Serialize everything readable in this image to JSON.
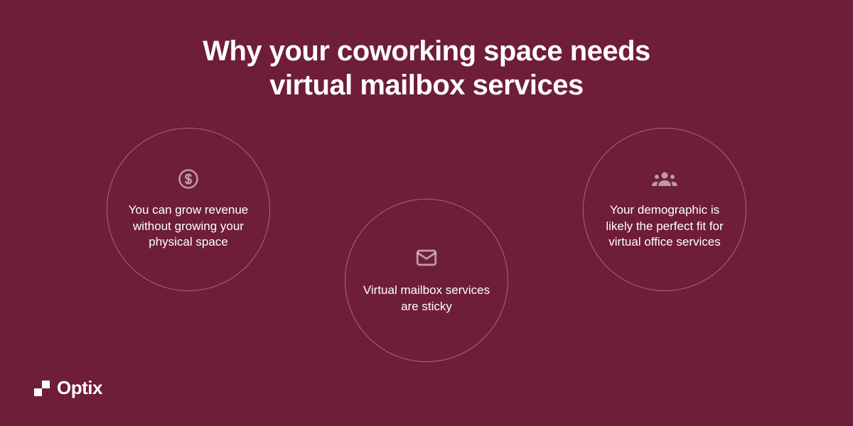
{
  "heading_line1": "Why your coworking space needs",
  "heading_line2": "virtual mailbox services",
  "circles": [
    {
      "label": "You can grow revenue without growing your physical space"
    },
    {
      "label": "Virtual mailbox services are sticky"
    },
    {
      "label": "Your demographic is likely the perfect fit for virtual office services"
    }
  ],
  "brand": {
    "name": "Optix"
  }
}
